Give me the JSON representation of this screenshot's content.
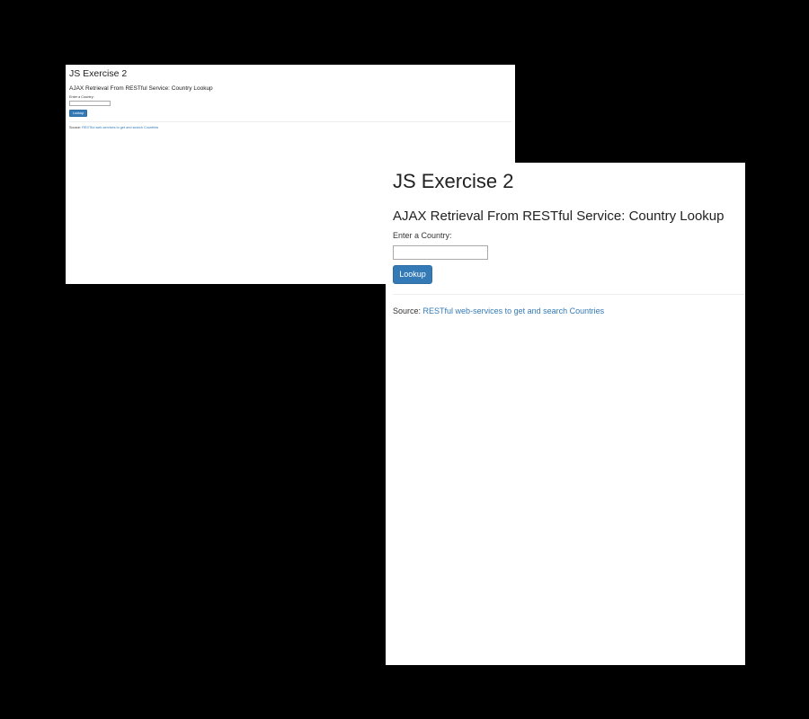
{
  "page": {
    "title": "JS Exercise 2",
    "subtitle": "AJAX Retrieval From RESTful Service: Country Lookup",
    "country_label": "Enter a Country:",
    "country_input_value": "",
    "lookup_button_label": "Lookup",
    "source_label": "Source:",
    "source_link_text": "RESTful web-services to get and search Countries"
  },
  "colors": {
    "backdrop": "#000000",
    "page_background": "#ffffff",
    "button_primary": "#337ab7",
    "link": "#337ab7",
    "text": "#222222"
  }
}
